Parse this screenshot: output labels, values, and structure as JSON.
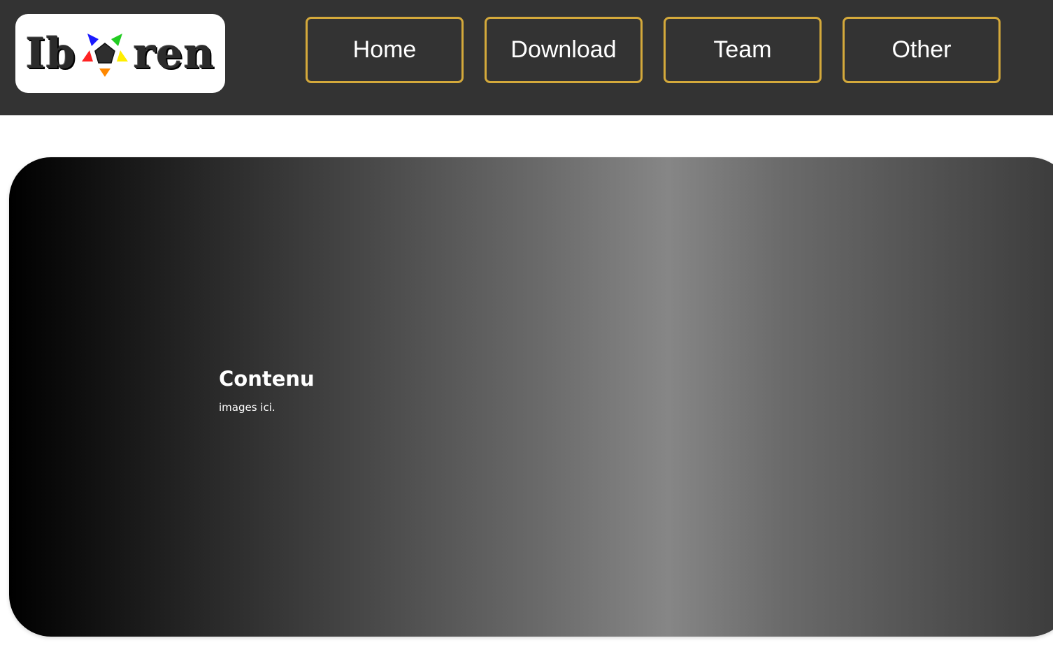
{
  "header": {
    "logo": {
      "text_left": "Ib",
      "text_right": "ren",
      "mark_icon": "pentagon-star-logo-icon",
      "mark_colors": [
        "#1a1aff",
        "#22cc22",
        "#ff2222",
        "#ffee00",
        "#ff8800"
      ]
    },
    "nav": [
      {
        "label": "Home"
      },
      {
        "label": "Download"
      },
      {
        "label": "Team"
      },
      {
        "label": "Other"
      }
    ],
    "colors": {
      "background": "#333333",
      "button_border": "#d4a93b"
    }
  },
  "main": {
    "title": "Contenu",
    "text": "images ici."
  }
}
